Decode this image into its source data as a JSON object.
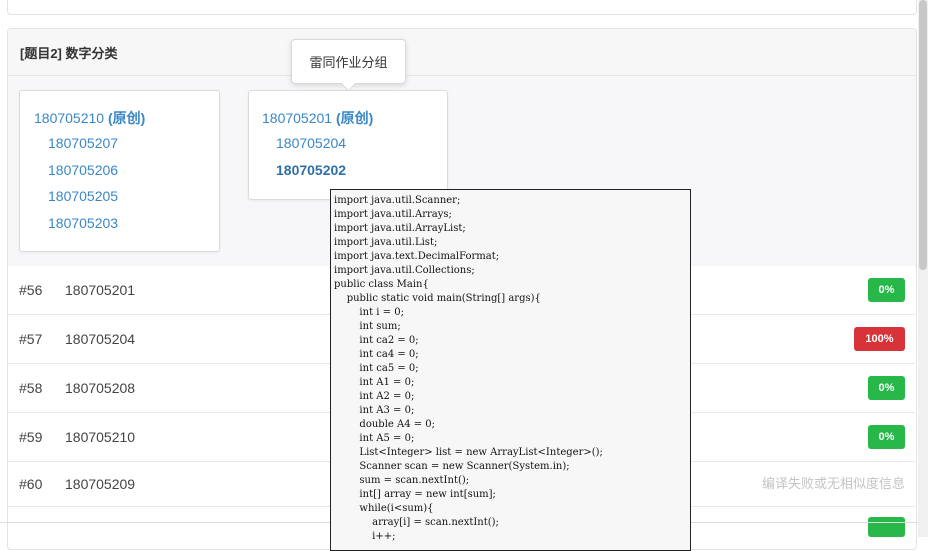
{
  "problem": {
    "title": "[题目2] 数字分类"
  },
  "tooltip": {
    "text": "雷同作业分组"
  },
  "groups": [
    {
      "head": "180705210",
      "head_tag": "(原创)",
      "members": [
        "180705207",
        "180705206",
        "180705205",
        "180705203"
      ]
    },
    {
      "head": "180705201",
      "head_tag": "(原创)",
      "members": [
        "180705204",
        "180705202"
      ]
    }
  ],
  "rows": [
    {
      "num": "#56",
      "sid": "180705201",
      "badge": "0%",
      "badge_color": "#28b84a"
    },
    {
      "num": "#57",
      "sid": "180705204",
      "badge": "100%",
      "badge_color": "#d9333a"
    },
    {
      "num": "#58",
      "sid": "180705208",
      "badge": "0%",
      "badge_color": "#28b84a"
    },
    {
      "num": "#59",
      "sid": "180705210",
      "badge": "0%",
      "badge_color": "#28b84a"
    },
    {
      "num": "#60",
      "sid": "180705209",
      "message": "编译失败或无相似度信息"
    }
  ],
  "code": {
    "lines": [
      "import java.util.Scanner;",
      "import java.util.Arrays;",
      "import java.util.ArrayList;",
      "import java.util.List;",
      "import java.text.DecimalFormat;",
      "import java.util.Collections;",
      "public class Main{",
      "    public static void main(String[] args){",
      "        int i = 0;",
      "        int sum;",
      "        int ca2 = 0;",
      "        int ca4 = 0;",
      "        int ca5 = 0;",
      "        int A1 = 0;",
      "        int A2 = 0;",
      "        int A3 = 0;",
      "        double A4 = 0;",
      "        int A5 = 0;",
      "        List<Integer> list = new ArrayList<Integer>();",
      "        Scanner scan = new Scanner(System.in);",
      "        sum = scan.nextInt();",
      "        int[] array = new int[sum];",
      "        while(i<sum){",
      "            array[i] = scan.nextInt();",
      "            i++;"
    ]
  },
  "colors": {
    "link": "#3a87c8",
    "success": "#28b84a",
    "danger": "#d9333a"
  }
}
